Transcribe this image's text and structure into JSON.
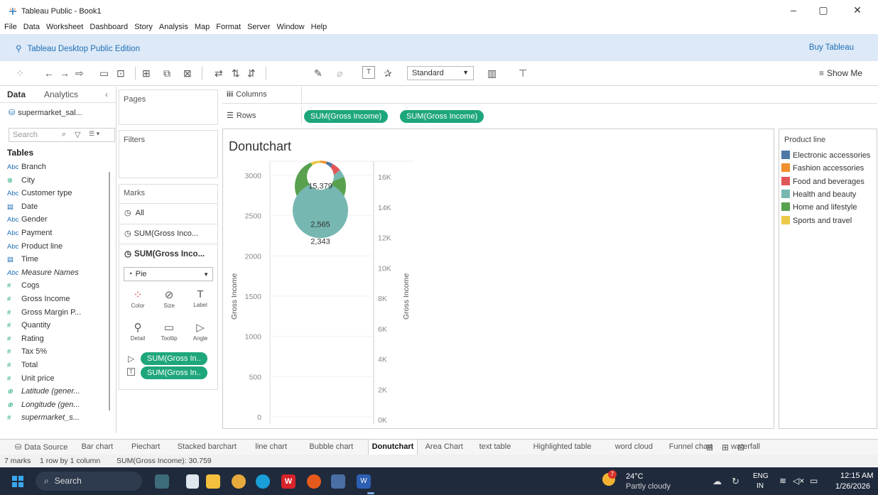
{
  "window": {
    "title": "Tableau Public - Book1",
    "minimize": "–",
    "maximize": "▢",
    "close": "✕"
  },
  "menu": [
    "File",
    "Data",
    "Worksheet",
    "Dashboard",
    "Story",
    "Analysis",
    "Map",
    "Format",
    "Server",
    "Window",
    "Help"
  ],
  "banner": {
    "edition": "Tableau Desktop Public Edition",
    "buy": "Buy Tableau"
  },
  "toolbar": {
    "standard": "Standard",
    "show_me": "Show Me"
  },
  "data_pane": {
    "tab_data": "Data",
    "tab_analytics": "Analytics",
    "source": "supermarket_sal...",
    "search_placeholder": "Search",
    "tables_label": "Tables",
    "fields": [
      {
        "icon": "Abc",
        "name": "Branch"
      },
      {
        "icon": "⊕",
        "name": "City"
      },
      {
        "icon": "Abc",
        "name": "Customer type"
      },
      {
        "icon": "▤",
        "name": "Date"
      },
      {
        "icon": "Abc",
        "name": "Gender"
      },
      {
        "icon": "Abc",
        "name": "Payment"
      },
      {
        "icon": "Abc",
        "name": "Product line"
      },
      {
        "icon": "▤",
        "name": "Time"
      },
      {
        "icon": "Abc",
        "name": "Measure Names",
        "italic": true
      },
      {
        "icon": "#",
        "name": "Cogs"
      },
      {
        "icon": "#",
        "name": "Gross Income"
      },
      {
        "icon": "#",
        "name": "Gross Margin P..."
      },
      {
        "icon": "#",
        "name": "Quantity"
      },
      {
        "icon": "#",
        "name": "Rating"
      },
      {
        "icon": "#",
        "name": "Tax 5%"
      },
      {
        "icon": "#",
        "name": "Total"
      },
      {
        "icon": "#",
        "name": "Unit price"
      },
      {
        "icon": "⊕",
        "name": "Latitude (gener...",
        "italic": true
      },
      {
        "icon": "⊕",
        "name": "Longitude (gen...",
        "italic": true
      },
      {
        "icon": "#",
        "name": "supermarket_s...",
        "italic": true
      }
    ]
  },
  "cards": {
    "pages": "Pages",
    "filters": "Filters",
    "marks": "Marks",
    "marks_all": "All",
    "marks_sum1": "SUM(Gross Inco...",
    "marks_sum2": "SUM(Gross Inco...",
    "mark_type": "Pie",
    "buttons": [
      "Color",
      "Size",
      "Label",
      "Detail",
      "Tooltip",
      "Angle"
    ],
    "angle_pill": "SUM(Gross In..",
    "label_pill": "SUM(Gross In.."
  },
  "shelves": {
    "columns": "Columns",
    "rows": "Rows",
    "row_pills": [
      "SUM(Gross Income)",
      "SUM(Gross Income)"
    ]
  },
  "chart_data": {
    "type": "pie",
    "title": "Donutchart",
    "left_axis": {
      "label": "Gross Income",
      "ticks": [
        "3000",
        "2500",
        "2000",
        "1500",
        "1000",
        "500",
        "0"
      ],
      "ylim": [
        0,
        3000
      ]
    },
    "right_axis": {
      "label": "Gross Income",
      "ticks": [
        "16K",
        "14K",
        "12K",
        "10K",
        "8K",
        "6K",
        "4K",
        "2K",
        "0K"
      ],
      "ylim": [
        0,
        16000
      ]
    },
    "data_labels": [
      "15,379",
      "2,565",
      "2,343"
    ],
    "marks": [
      {
        "name": "outer-pie",
        "value": 15379,
        "axis": "right"
      },
      {
        "name": "inner-circle",
        "value": 2565,
        "axis": "left"
      }
    ]
  },
  "legend": {
    "title": "Product line",
    "items": [
      {
        "label": "Electronic accessories",
        "color": "#4e79a7"
      },
      {
        "label": "Fashion accessories",
        "color": "#f28e2b"
      },
      {
        "label": "Food and beverages",
        "color": "#e15759"
      },
      {
        "label": "Health and beauty",
        "color": "#76b7b2"
      },
      {
        "label": "Home and lifestyle",
        "color": "#59a14f"
      },
      {
        "label": "Sports and travel",
        "color": "#edc948"
      }
    ]
  },
  "sheet_tabs": [
    "Data Source",
    "Bar chart",
    "Piechart",
    "Stacked barchart",
    "line chart",
    "Bubble chart",
    "Donutchart",
    "Area Chart",
    "text table",
    "Highlighted table",
    "word cloud",
    "Funnel chart",
    "waterfall"
  ],
  "active_tab": "Donutchart",
  "status": {
    "marks": "7 marks",
    "rows": "1 row by 1 column",
    "sum": "SUM(Gross Income): 30.759"
  },
  "taskbar": {
    "search": "Search",
    "weather_temp": "24°C",
    "weather_desc": "Partly cloudy",
    "weather_badge": "7",
    "lang": "ENG",
    "lang2": "IN",
    "time": "12:15 AM",
    "date": "1/26/2026"
  }
}
